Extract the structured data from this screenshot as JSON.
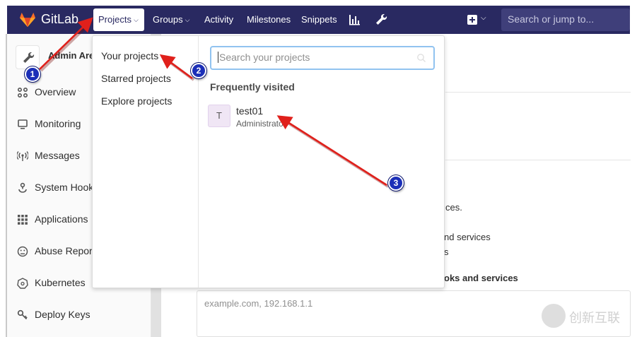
{
  "navbar": {
    "brand": "GitLab",
    "projects_label": "Projects",
    "items": [
      "Groups",
      "Activity",
      "Milestones",
      "Snippets"
    ],
    "groups_label": "Groups",
    "activity_label": "Activity",
    "milestones_label": "Milestones",
    "snippets_label": "Snippets",
    "search_placeholder": "Search or jump to...",
    "bg_color": "#292961"
  },
  "sidebar": {
    "title": "Admin Area",
    "items": [
      {
        "label": "Overview",
        "icon": "overview-icon"
      },
      {
        "label": "Monitoring",
        "icon": "monitoring-icon"
      },
      {
        "label": "Messages",
        "icon": "messages-icon"
      },
      {
        "label": "System Hooks",
        "icon": "hook-icon"
      },
      {
        "label": "Applications",
        "icon": "applications-icon"
      },
      {
        "label": "Abuse Reports",
        "icon": "abuse-icon"
      },
      {
        "label": "Kubernetes",
        "icon": "kubernetes-icon"
      },
      {
        "label": "Deploy Keys",
        "icon": "key-icon"
      }
    ]
  },
  "dropdown": {
    "menu": [
      "Your projects",
      "Starred projects",
      "Explore projects"
    ],
    "search_placeholder": "Search your projects",
    "heading": "Frequently visited",
    "project": {
      "avatar_letter": "T",
      "name": "test01",
      "namespace": "Administrator"
    }
  },
  "content": {
    "fragment_1": "ces.",
    "fragment_2": "nd services",
    "fragment_3": "s",
    "fragment_4": "oks and services",
    "input_placeholder": "example.com, 192.168.1.1"
  },
  "annotations": {
    "badge_1": "1",
    "badge_2": "2",
    "badge_3": "3",
    "arrow_color": "#e0201b"
  },
  "watermark": {
    "text": "创新互联"
  }
}
